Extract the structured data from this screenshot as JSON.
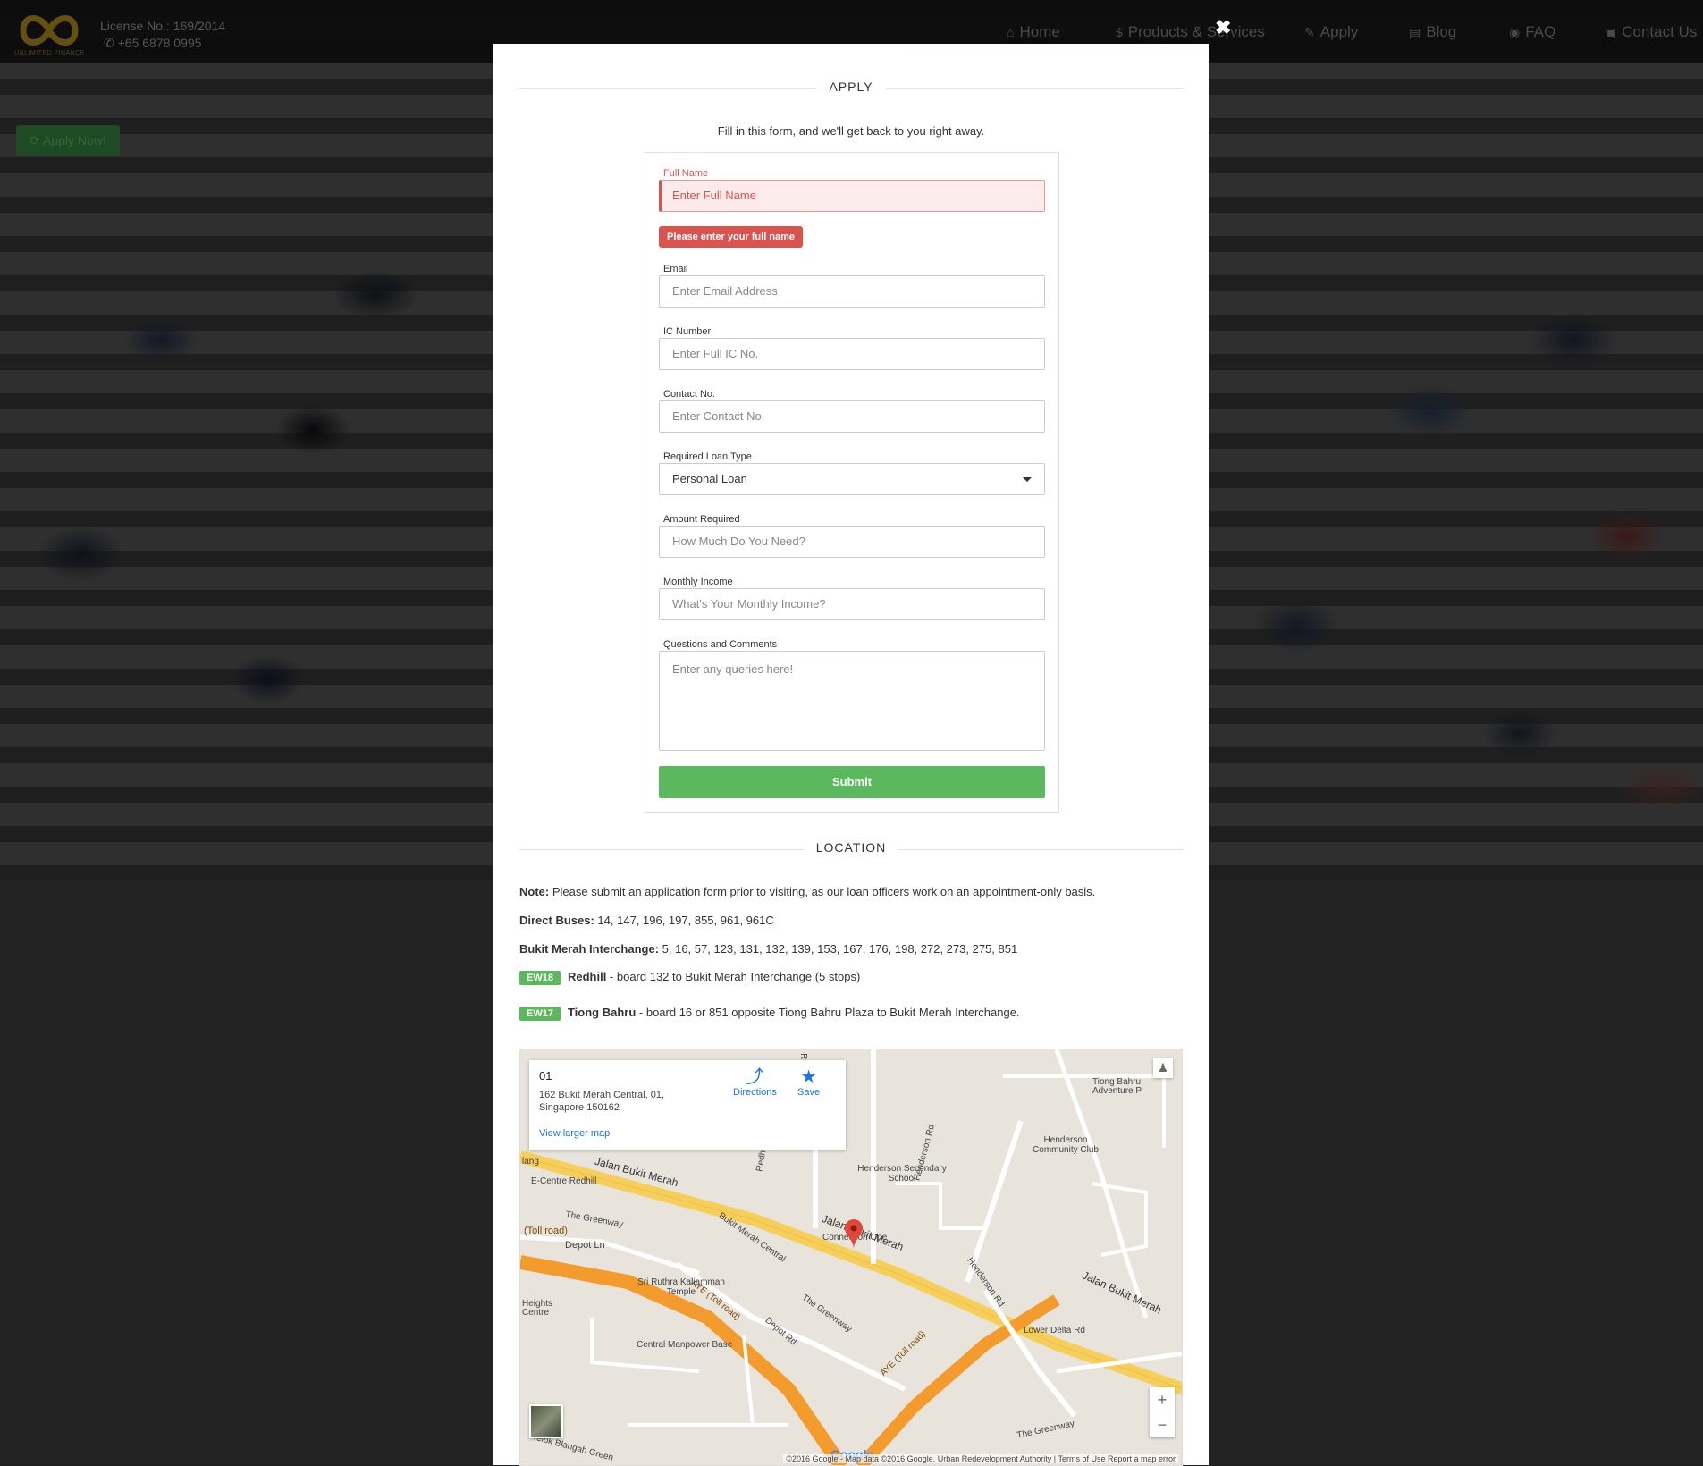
{
  "nav": {
    "license": "License No.: 169/2014",
    "phone": "+65 6878 0995",
    "logo_text": "UNLIMITED FINANCE",
    "links": [
      {
        "icon": "home-icon",
        "glyph": "⌂",
        "label": "Home"
      },
      {
        "icon": "dollar-icon",
        "glyph": "$",
        "label": "Products & Services"
      },
      {
        "icon": "edit-icon",
        "glyph": "✎",
        "label": "Apply"
      },
      {
        "icon": "newspaper-icon",
        "glyph": "▤",
        "label": "Blog"
      },
      {
        "icon": "map-marker-icon",
        "glyph": "◉",
        "label": "FAQ"
      },
      {
        "icon": "chat-icon",
        "glyph": "▣",
        "label": "Contact Us"
      }
    ]
  },
  "apply_now": "Apply Now!",
  "modal": {
    "close_glyph": "✖",
    "apply_title": "APPLY",
    "intro": "Fill in this form, and we'll get back to you right away.",
    "form": {
      "full_name_label": "Full Name",
      "full_name_placeholder": "Enter Full Name",
      "full_name_error": "Please enter your full name",
      "email_label": "Email",
      "email_placeholder": "Enter Email Address",
      "ic_label": "IC Number",
      "ic_placeholder": "Enter Full IC No.",
      "contact_label": "Contact No.",
      "contact_placeholder": "Enter Contact No.",
      "loan_type_label": "Required Loan Type",
      "loan_type_value": "Personal Loan",
      "amount_label": "Amount Required",
      "amount_placeholder": "How Much Do You Need?",
      "income_label": "Monthly Income",
      "income_placeholder": "What's Your Monthly Income?",
      "questions_label": "Questions and Comments",
      "questions_placeholder": "Enter any queries here!",
      "submit": "Submit"
    },
    "location_title": "LOCATION",
    "note_label": "Note:",
    "note_text": " Please submit an application form prior to visiting, as our loan officers work on an appointment-only basis.",
    "buses_label": "Direct Buses:",
    "buses_text": " 14, 147, 196, 197, 855, 961, 961C",
    "interchange_label": "Bukit Merah Interchange:",
    "interchange_text": " 5, 16, 57, 123, 131, 132, 139, 153, 167, 176, 198, 272, 273, 275, 851",
    "mrt1_code": "EW18",
    "mrt1_name": "Redhill",
    "mrt1_text": " - board 132 to Bukit Merah Interchange (5 stops)",
    "mrt2_code": "EW17",
    "mrt2_name": "Tiong Bahru",
    "mrt2_text": " -  board 16 or 851 opposite Tiong Bahru Plaza to Bukit Merah Interchange.",
    "map": {
      "info_title": "01",
      "info_address": "162 Bukit Merah Central, 01, Singapore 150162",
      "directions": "Directions",
      "save": "Save",
      "view_larger": "View larger map",
      "copyright": "©2016 Google - Map data ©2016 Google, Urban Redevelopment Authority | Terms of Use   Report a map error",
      "labels": [
        "Jalan Bukit Merah",
        "Jalan Bukit Merah",
        "Jalan Bukit Merah",
        "E-Centre Redhill",
        "Henderson Secondary School",
        "Henderson Community Club",
        "Connection One",
        "Bukit Merah Central",
        "The Greenway",
        "Depot Ln",
        "AYE (Toll road)",
        "AYE (Toll road)",
        "Sri Ruthra Kaliamman Temple",
        "Central Manpower Base",
        "Henderson Rd",
        "Henderson Rd",
        "Lower Delta Rd",
        "Redhill Cl",
        "Redhill Cl",
        "Depot Rd",
        "(Toll road)",
        "Tiong Bahru Adventure P",
        "Telok Blangah Green",
        "Heights Centre",
        "lang",
        "The Greenway",
        "The Greenway"
      ],
      "google": "Google"
    }
  }
}
